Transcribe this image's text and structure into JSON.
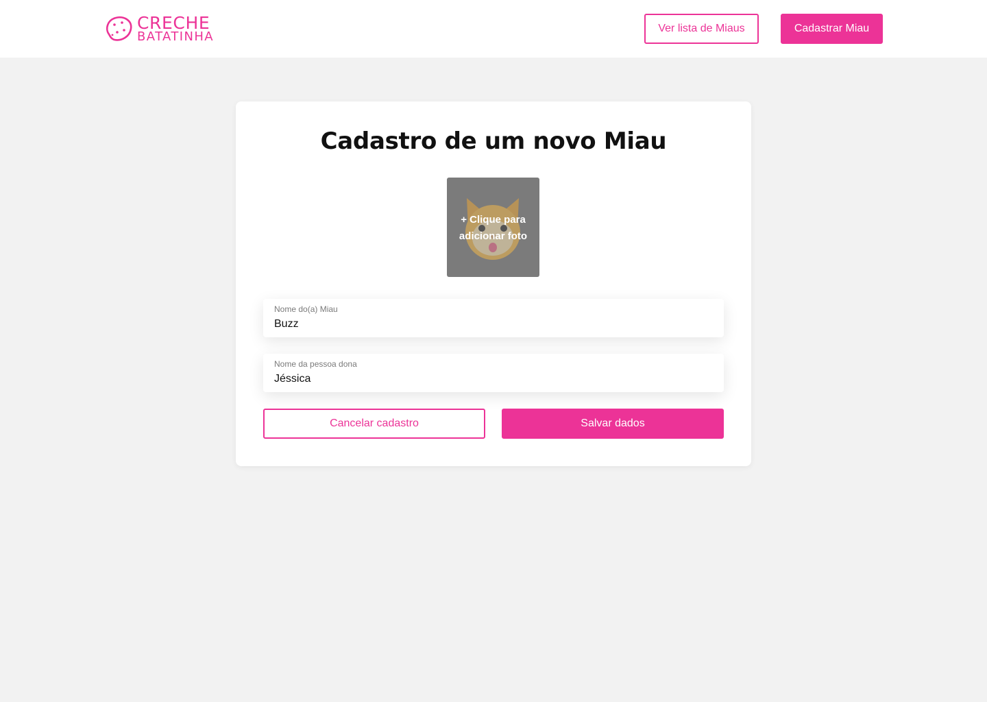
{
  "brand": {
    "line1": "CRECHE",
    "line2": "BATATINHA",
    "icon": "potato-icon",
    "color": "#ec3397"
  },
  "nav": {
    "list_label": "Ver lista de Miaus",
    "register_label": "Cadastrar Miau"
  },
  "form": {
    "title": "Cadastro de um novo Miau",
    "photo": {
      "icon": "cat-placeholder-icon",
      "line1": "+ Clique para",
      "line2": "adicionar foto"
    },
    "fields": [
      {
        "label": "Nome do(a) Miau",
        "value": "Buzz"
      },
      {
        "label": "Nome da pessoa dona",
        "value": "Jéssica"
      }
    ],
    "cancel_label": "Cancelar cadastro",
    "save_label": "Salvar dados"
  },
  "colors": {
    "accent": "#ec3397",
    "background": "#f2f2f2",
    "card": "#ffffff"
  }
}
